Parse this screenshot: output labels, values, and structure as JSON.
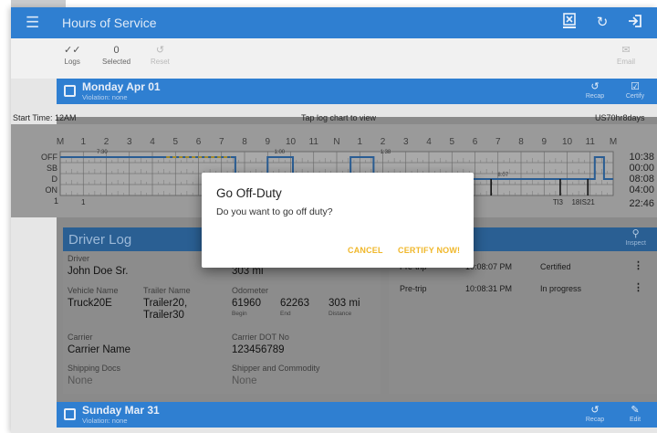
{
  "appbar": {
    "title": "Hours of Service",
    "icons": [
      "menu-icon",
      "dot-inspection-icon",
      "refresh-icon",
      "logout-icon"
    ],
    "color": "#2f7fd1"
  },
  "toolbar": {
    "logs_label": "Logs",
    "selected_count": "0",
    "selected_label": "Selected",
    "reset_label": "Reset",
    "email_label": "Email"
  },
  "day_monday": {
    "title": "Monday Apr 01",
    "violation": "Violation: none",
    "recap_label": "Recap",
    "certify_label": "Certify"
  },
  "log_info": {
    "start_time": "Start Time: 12AM",
    "tap_hint": "Tap log chart to view",
    "ruleset": "US70hr8days"
  },
  "graph": {
    "hour_labels": [
      "M",
      "1",
      "2",
      "3",
      "4",
      "5",
      "6",
      "7",
      "8",
      "9",
      "10",
      "11",
      "N",
      "1",
      "2",
      "3",
      "4",
      "5",
      "6",
      "7",
      "8",
      "9",
      "10",
      "11",
      "M"
    ],
    "rows": [
      "OFF",
      "SB",
      "D",
      "ON"
    ],
    "totals": [
      "10:38",
      "00:00",
      "08:08",
      "04:00"
    ],
    "grand_total": "22:46",
    "tags_top": [
      "7:30",
      "1:00",
      "1:38"
    ],
    "tag_d": "8:07",
    "bottom_left": "1",
    "bottom_markers": [
      "1",
      "Tl3",
      "18IS21"
    ]
  },
  "driver_log": {
    "title": "Driver Log",
    "inspect_label": "Inspect",
    "driver_label": "Driver",
    "driver_name": "John Doe Sr.",
    "distance_top": "303 mi",
    "vehicle_label": "Vehicle Name",
    "vehicle_value": "Truck20E",
    "trailer_label": "Trailer Name",
    "trailer_value_1": "Trailer20,",
    "trailer_value_2": "Trailer30",
    "odometer_label": "Odometer",
    "odo_begin": "61960",
    "odo_begin_label": "Begin",
    "odo_end": "62263",
    "odo_end_label": "End",
    "odo_distance": "303 mi",
    "odo_distance_label": "Distance",
    "carrier_label": "Carrier",
    "carrier_value": "Carrier Name",
    "dot_label": "Carrier DOT No",
    "dot_value": "123456789",
    "shipping_label": "Shipping Docs",
    "shipping_value": "None",
    "shipper_label": "Shipper and Commodity",
    "shipper_value": "None"
  },
  "inspections": [
    {
      "type": "Pre-trip",
      "time": "10:08:07 PM",
      "status": "Certified"
    },
    {
      "type": "Pre-trip",
      "time": "10:08:31 PM",
      "status": "In progress"
    }
  ],
  "day_sunday": {
    "title": "Sunday Mar 31",
    "violation": "Violation: none",
    "recap_label": "Recap",
    "edit_label": "Edit"
  },
  "dialog": {
    "title": "Go Off-Duty",
    "message": "Do you want to go off duty?",
    "cancel": "CANCEL",
    "certify_now": "CERTIFY NOW!",
    "accent": "#f0b72a"
  }
}
